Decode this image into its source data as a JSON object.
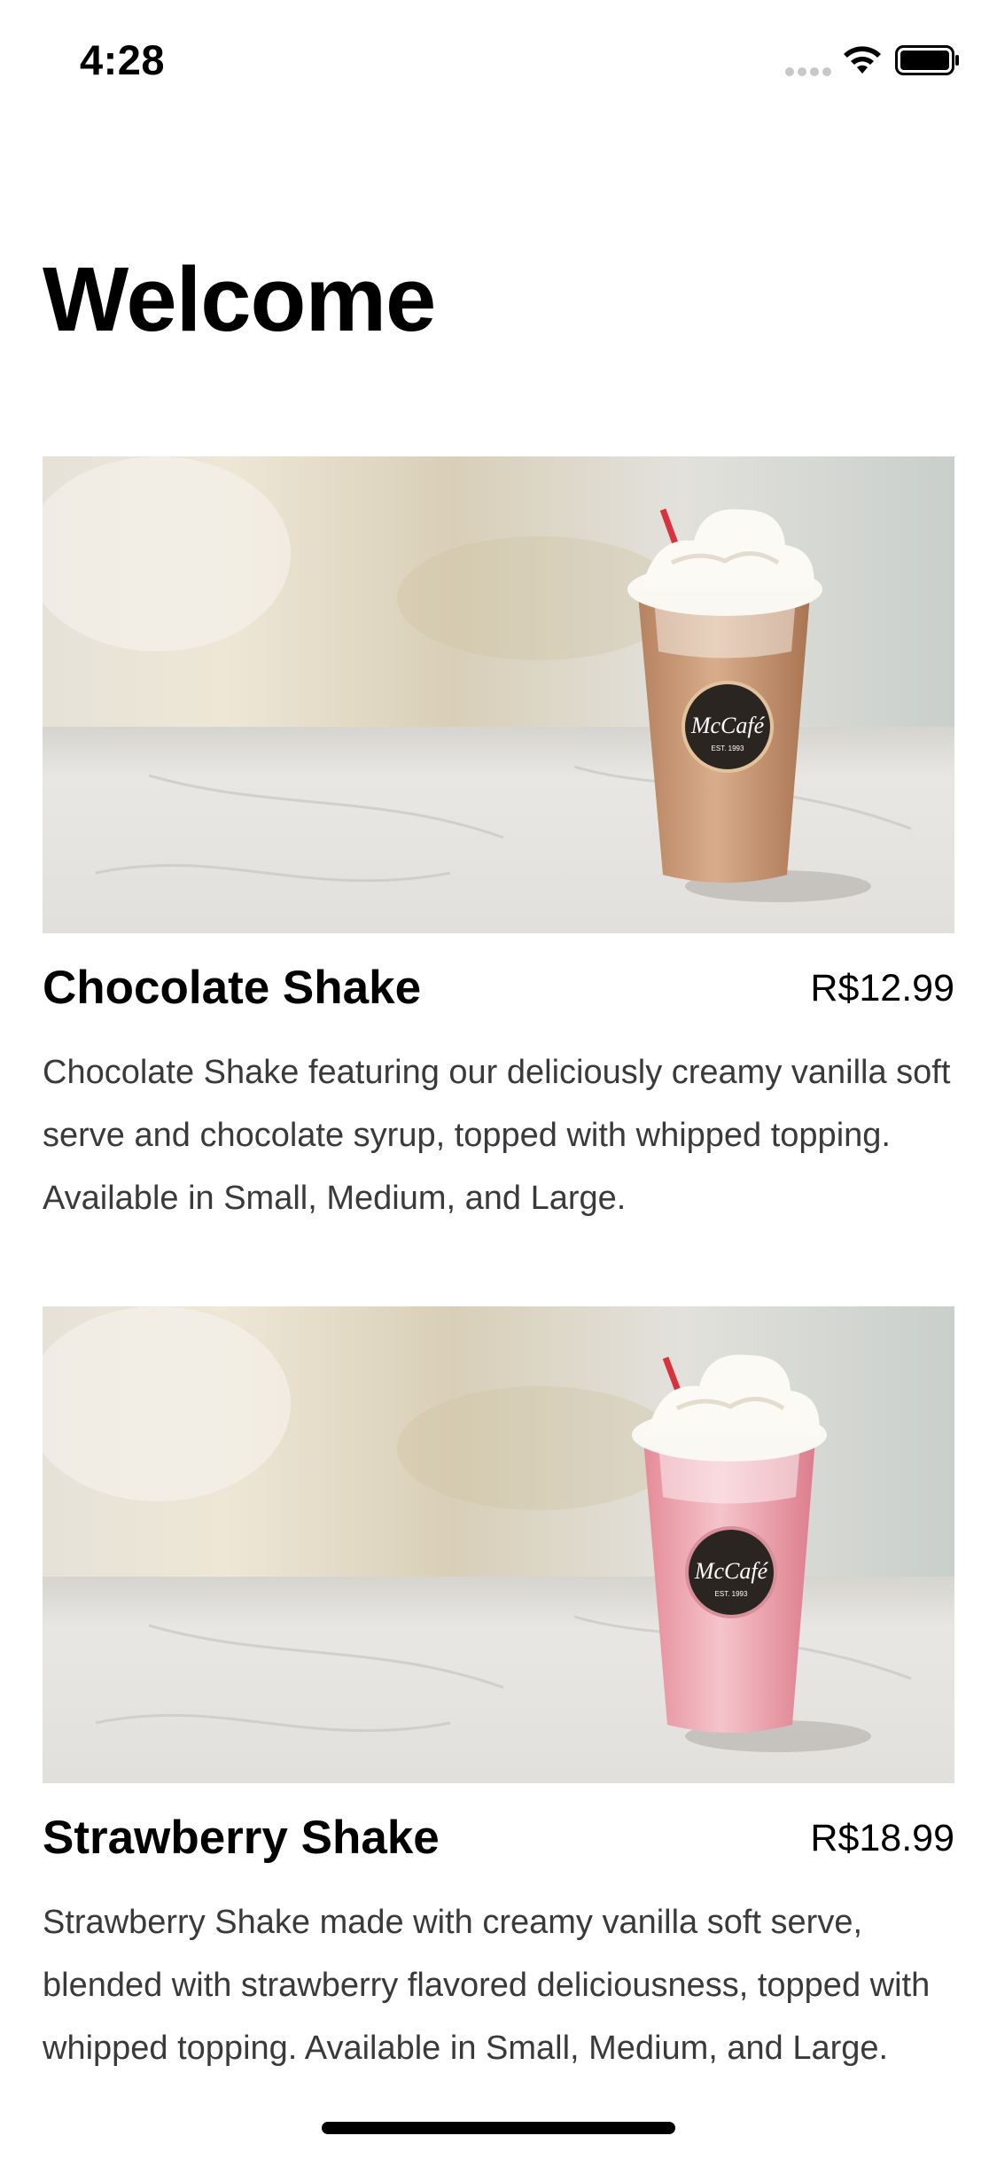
{
  "status_bar": {
    "time": "4:28",
    "icons": [
      "signal-dots-icon",
      "wifi-icon",
      "battery-icon"
    ]
  },
  "page": {
    "title": "Welcome"
  },
  "products": [
    {
      "name": "Chocolate Shake",
      "price": "R$12.99",
      "description": "Chocolate Shake featuring our deliciously creamy vanilla soft serve and chocolate syrup, topped with whipped topping. Available in Small, Medium, and Large.",
      "image_logo_text": "McCafé",
      "image_logo_subtext": "EST. 1993",
      "drink_color": "#c99a78"
    },
    {
      "name": "Strawberry Shake",
      "price": "R$18.99",
      "description": "Strawberry Shake made with creamy vanilla soft serve, blended with strawberry flavored deliciousness, topped with whipped topping. Available in Small, Medium, and Large.",
      "image_logo_text": "McCafé",
      "image_logo_subtext": "EST. 1993",
      "drink_color": "#eba3ad"
    }
  ]
}
